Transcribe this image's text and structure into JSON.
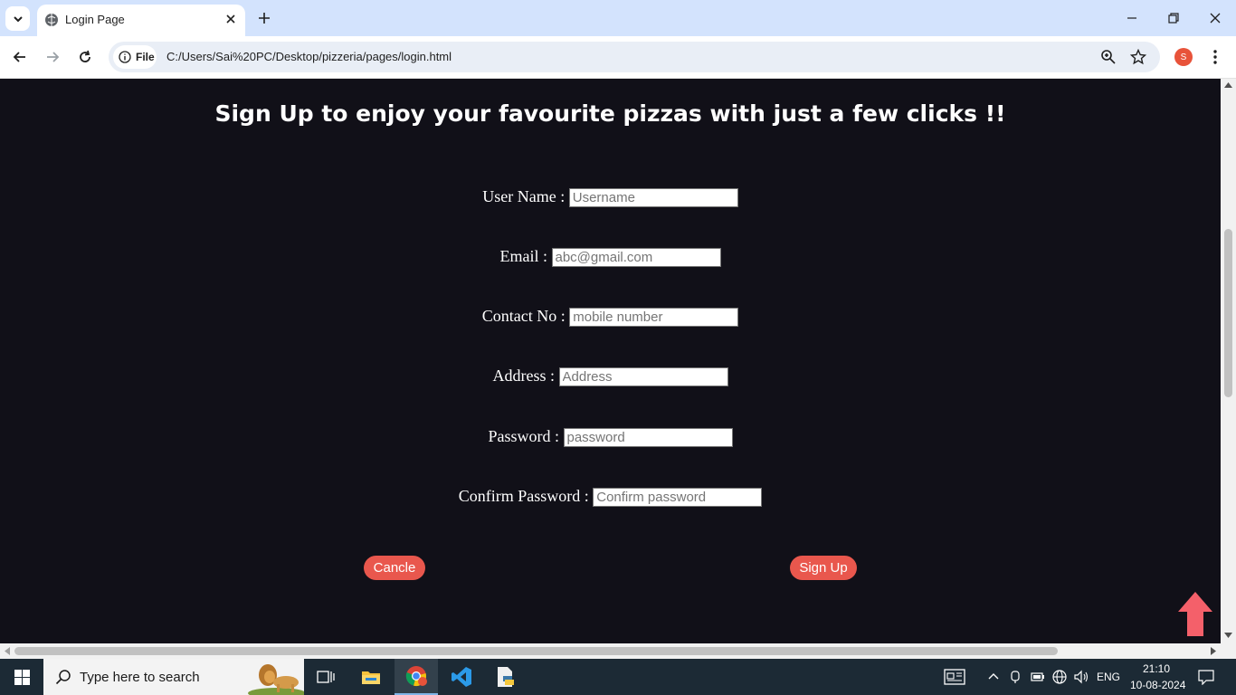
{
  "browser": {
    "tab_title": "Login Page",
    "address_chip": "File",
    "url": "C:/Users/Sai%20PC/Desktop/pizzeria/pages/login.html",
    "avatar_letter": "S"
  },
  "page": {
    "heading": "Sign Up to enjoy your favourite pizzas with just a few clicks !!",
    "fields": {
      "username": {
        "label": "User Name :",
        "placeholder": "Username"
      },
      "email": {
        "label": "Email :",
        "placeholder": "abc@gmail.com"
      },
      "contact": {
        "label": "Contact No :",
        "placeholder": "mobile number"
      },
      "address": {
        "label": "Address :",
        "placeholder": "Address"
      },
      "password": {
        "label": "Password :",
        "placeholder": "password"
      },
      "confirm": {
        "label": "Confirm Password :",
        "placeholder": "Confirm password"
      }
    },
    "cancel_label": "Cancle",
    "signup_label": "Sign Up",
    "accent_color": "#e9574d",
    "background_color": "#111018"
  },
  "taskbar": {
    "search_placeholder": "Type here to search",
    "language": "ENG",
    "time": "21:10",
    "date": "10-08-2024"
  }
}
